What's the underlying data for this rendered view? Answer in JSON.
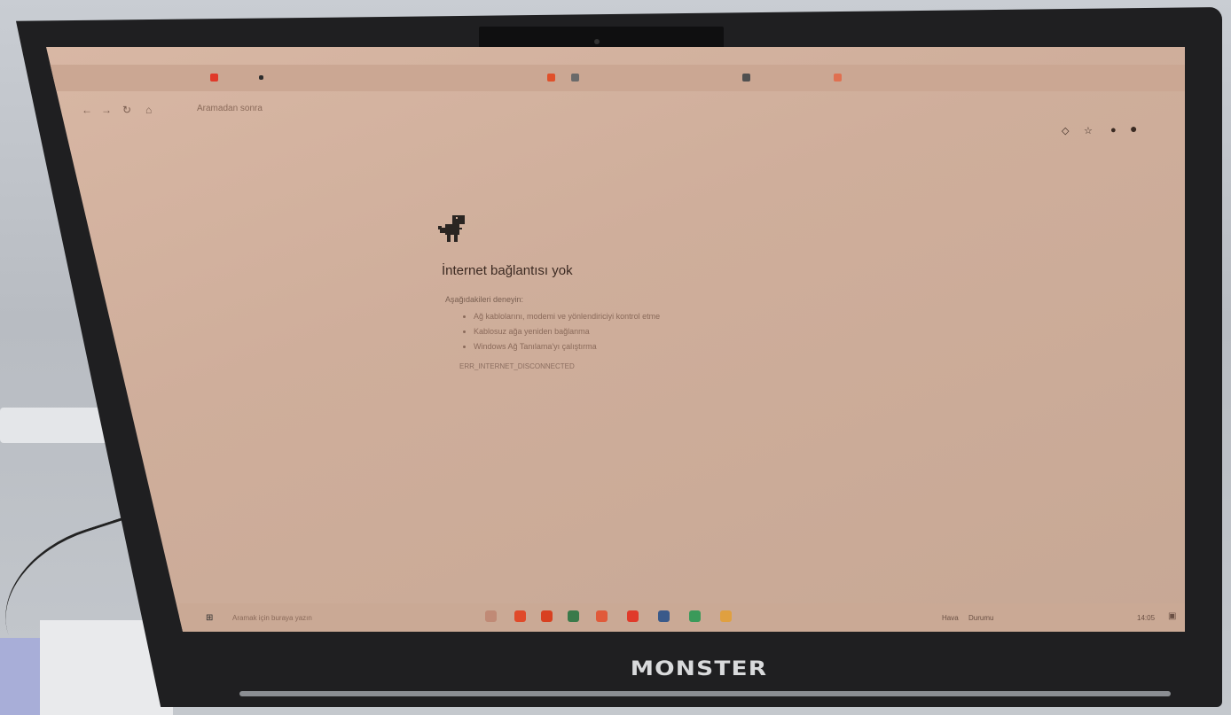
{
  "browser": {
    "url": "Aramadan sonra",
    "nav_back": "←",
    "nav_forward": "→",
    "nav_reload": "↻",
    "nav_home": "⌂"
  },
  "error": {
    "title": "İnternet bağlantısı yok",
    "subtitle": "Aşağıdakileri deneyin:",
    "items": [
      "Ağ kablolarını, modemi ve yönlendiriciyi kontrol etme",
      "Kablosuz ağa yeniden bağlanma",
      "Windows Ağ Tanılama'yı çalıştırma"
    ],
    "code": "ERR_INTERNET_DISCONNECTED"
  },
  "taskbar": {
    "search_placeholder": "Aramak için buraya yazın",
    "tray": [
      "Hava",
      "Durumu"
    ],
    "time": "14:05"
  },
  "laptop": {
    "brand": "MONSTER"
  },
  "colors": {
    "screen_bg": "#cfae9b",
    "bezel": "#1f1f21"
  }
}
